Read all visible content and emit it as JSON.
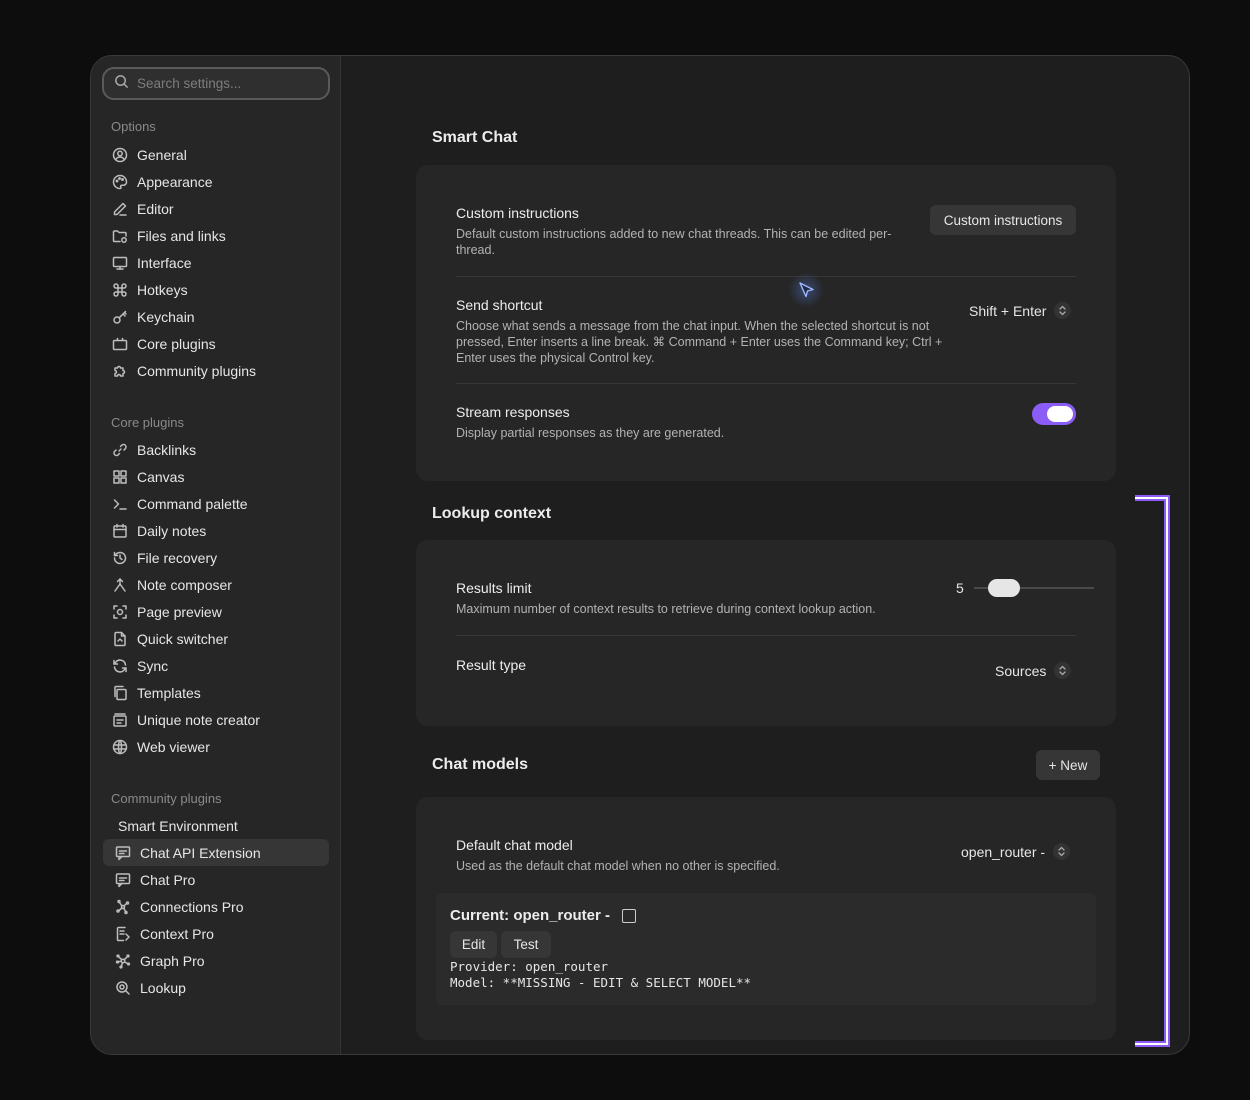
{
  "search": {
    "placeholder": "Search settings..."
  },
  "sidebar": {
    "options_heading": "Options",
    "options": [
      {
        "label": "General",
        "icon": "user-circle-icon"
      },
      {
        "label": "Appearance",
        "icon": "palette-icon"
      },
      {
        "label": "Editor",
        "icon": "pencil-icon"
      },
      {
        "label": "Files and links",
        "icon": "folder-link-icon"
      },
      {
        "label": "Interface",
        "icon": "monitor-icon"
      },
      {
        "label": "Hotkeys",
        "icon": "command-icon"
      },
      {
        "label": "Keychain",
        "icon": "key-icon"
      },
      {
        "label": "Core plugins",
        "icon": "briefcase-icon"
      },
      {
        "label": "Community plugins",
        "icon": "puzzle-icon"
      }
    ],
    "core_heading": "Core plugins",
    "core": [
      {
        "label": "Backlinks",
        "icon": "backlink-icon"
      },
      {
        "label": "Canvas",
        "icon": "grid-icon"
      },
      {
        "label": "Command palette",
        "icon": "terminal-icon"
      },
      {
        "label": "Daily notes",
        "icon": "calendar-icon"
      },
      {
        "label": "File recovery",
        "icon": "history-icon"
      },
      {
        "label": "Note composer",
        "icon": "merge-icon"
      },
      {
        "label": "Page preview",
        "icon": "preview-icon"
      },
      {
        "label": "Quick switcher",
        "icon": "file-switch-icon"
      },
      {
        "label": "Sync",
        "icon": "sync-icon"
      },
      {
        "label": "Templates",
        "icon": "templates-icon"
      },
      {
        "label": "Unique note creator",
        "icon": "note-creator-icon"
      },
      {
        "label": "Web viewer",
        "icon": "globe-icon"
      }
    ],
    "community_heading": "Community plugins",
    "community": [
      {
        "label": "Smart Environment",
        "icon": ""
      },
      {
        "label": "Chat API Extension",
        "icon": "chat-icon",
        "active": true
      },
      {
        "label": "Chat Pro",
        "icon": "chat-icon"
      },
      {
        "label": "Connections Pro",
        "icon": "network-icon"
      },
      {
        "label": "Context Pro",
        "icon": "context-icon"
      },
      {
        "label": "Graph Pro",
        "icon": "graph-icon"
      },
      {
        "label": "Lookup",
        "icon": "lookup-icon"
      }
    ]
  },
  "smart_chat": {
    "title": "Smart Chat",
    "custom_instructions": {
      "title": "Custom instructions",
      "desc": "Default custom instructions added to new chat threads. This can be edited per-thread.",
      "button": "Custom instructions"
    },
    "send_shortcut": {
      "title": "Send shortcut",
      "desc": "Choose what sends a message from the chat input. When the selected shortcut is not pressed, Enter inserts a line break. ⌘ Command + Enter uses the Command key; Ctrl + Enter uses the physical Control key.",
      "value": "Shift + Enter"
    },
    "stream_responses": {
      "title": "Stream responses",
      "desc": "Display partial responses as they are generated.",
      "enabled": true
    }
  },
  "lookup_context": {
    "title": "Lookup context",
    "results_limit": {
      "title": "Results limit",
      "desc": "Maximum number of context results to retrieve during context lookup action.",
      "value": "5"
    },
    "result_type": {
      "title": "Result type",
      "value": "Sources"
    }
  },
  "chat_models": {
    "title": "Chat models",
    "new_button": "+ New",
    "default_model": {
      "title": "Default chat model",
      "desc": "Used as the default chat model when no other is specified.",
      "value": "open_router -"
    },
    "current": {
      "title": "Current: open_router -",
      "edit": "Edit",
      "test": "Test",
      "provider": "Provider: open_router",
      "model": "Model: **MISSING - EDIT & SELECT MODEL**"
    }
  },
  "colors": {
    "accent": "#8b5cf6",
    "background": "#1e1e1e",
    "card": "#262626"
  }
}
